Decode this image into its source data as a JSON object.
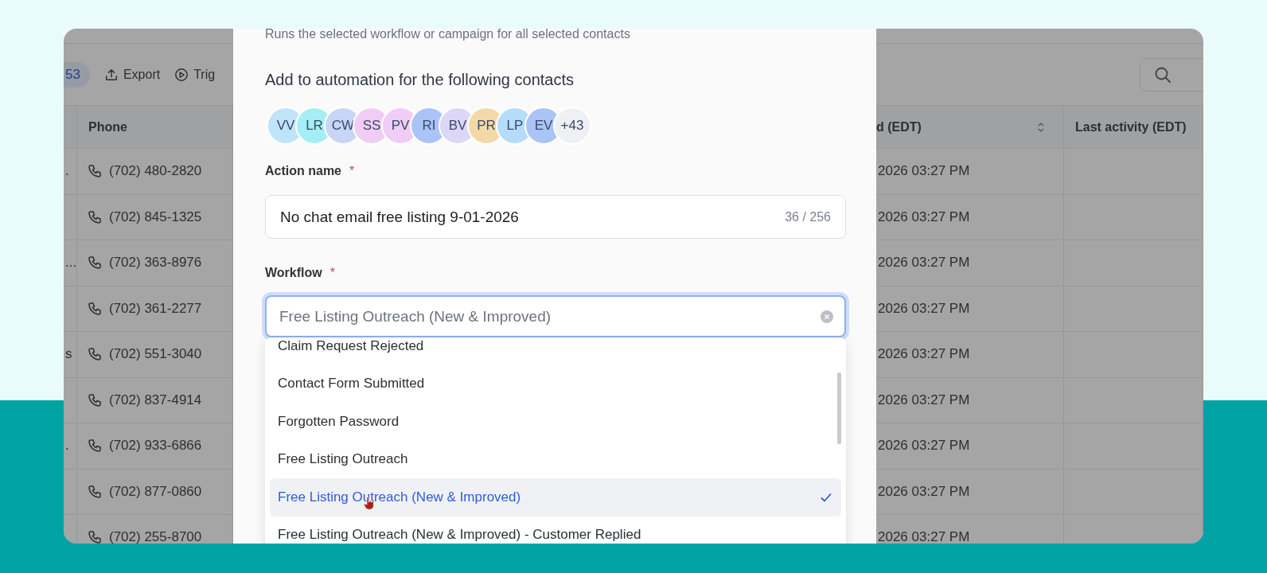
{
  "toolbar": {
    "count_badge": "53",
    "export_button": "Export",
    "trigger_button": "Trig"
  },
  "table": {
    "columns": [
      "Phone",
      "d (EDT)",
      "Last activity (EDT)"
    ],
    "rows": [
      {
        "column_1": ".",
        "phone": "(702) 480-2820",
        "date": "2026 03:27 PM"
      },
      {
        "phone": "(702) 845-1325",
        "date": "2026 03:27 PM"
      },
      {
        "column_1": "...",
        "phone": "(702) 363-8976",
        "date": "2026 03:27 PM"
      },
      {
        "phone": "(702) 361-2277",
        "date": "2026 03:27 PM"
      },
      {
        "column_1": "s",
        "phone": "(702) 551-3040",
        "date": "2026 03:27 PM"
      },
      {
        "phone": "(702) 837-4914",
        "date": "2026 03:27 PM"
      },
      {
        "column_1": ".",
        "phone": "(702) 933-6866",
        "date": "2026 03:27 PM"
      },
      {
        "phone": "(702) 877-0860",
        "date": "2026 03:27 PM"
      },
      {
        "phone": "(702) 255-8700",
        "date": "2026 03:27 PM"
      }
    ]
  },
  "modal": {
    "subtitle": "Runs the selected workflow or campaign for all selected contacts",
    "heading": "Add to automation for the following contacts",
    "contacts": [
      {
        "initials": "VV",
        "color": "#bfe3f8"
      },
      {
        "initials": "LR",
        "color": "#a5eef5"
      },
      {
        "initials": "CW",
        "color": "#c7d5f7"
      },
      {
        "initials": "SS",
        "color": "#f1cdf5"
      },
      {
        "initials": "PV",
        "color": "#efcdf7"
      },
      {
        "initials": "RI",
        "color": "#aac4f7"
      },
      {
        "initials": "BV",
        "color": "#dcd6f7"
      },
      {
        "initials": "PR",
        "color": "#f3d9a8"
      },
      {
        "initials": "LP",
        "color": "#b5dcfa"
      },
      {
        "initials": "EV",
        "color": "#a9c4f5"
      }
    ],
    "more_contacts": "+43",
    "action_name": {
      "label": "Action name",
      "required_mark": "*",
      "value": "No chat email free listing 9-01-2026",
      "counter": "36 / 256"
    },
    "workflow": {
      "label": "Workflow",
      "required_mark": "*",
      "placeholder": "Free Listing Outreach (New & Improved)",
      "options": [
        {
          "label": "Claim Request Rejected",
          "selected": false
        },
        {
          "label": "Contact Form Submitted",
          "selected": false
        },
        {
          "label": "Forgotten Password",
          "selected": false
        },
        {
          "label": "Free Listing Outreach",
          "selected": false
        },
        {
          "label": "Free Listing Outreach (New & Improved)",
          "selected": true
        },
        {
          "label": "Free Listing Outreach (New & Improved) - Customer Replied",
          "selected": false
        }
      ]
    }
  }
}
